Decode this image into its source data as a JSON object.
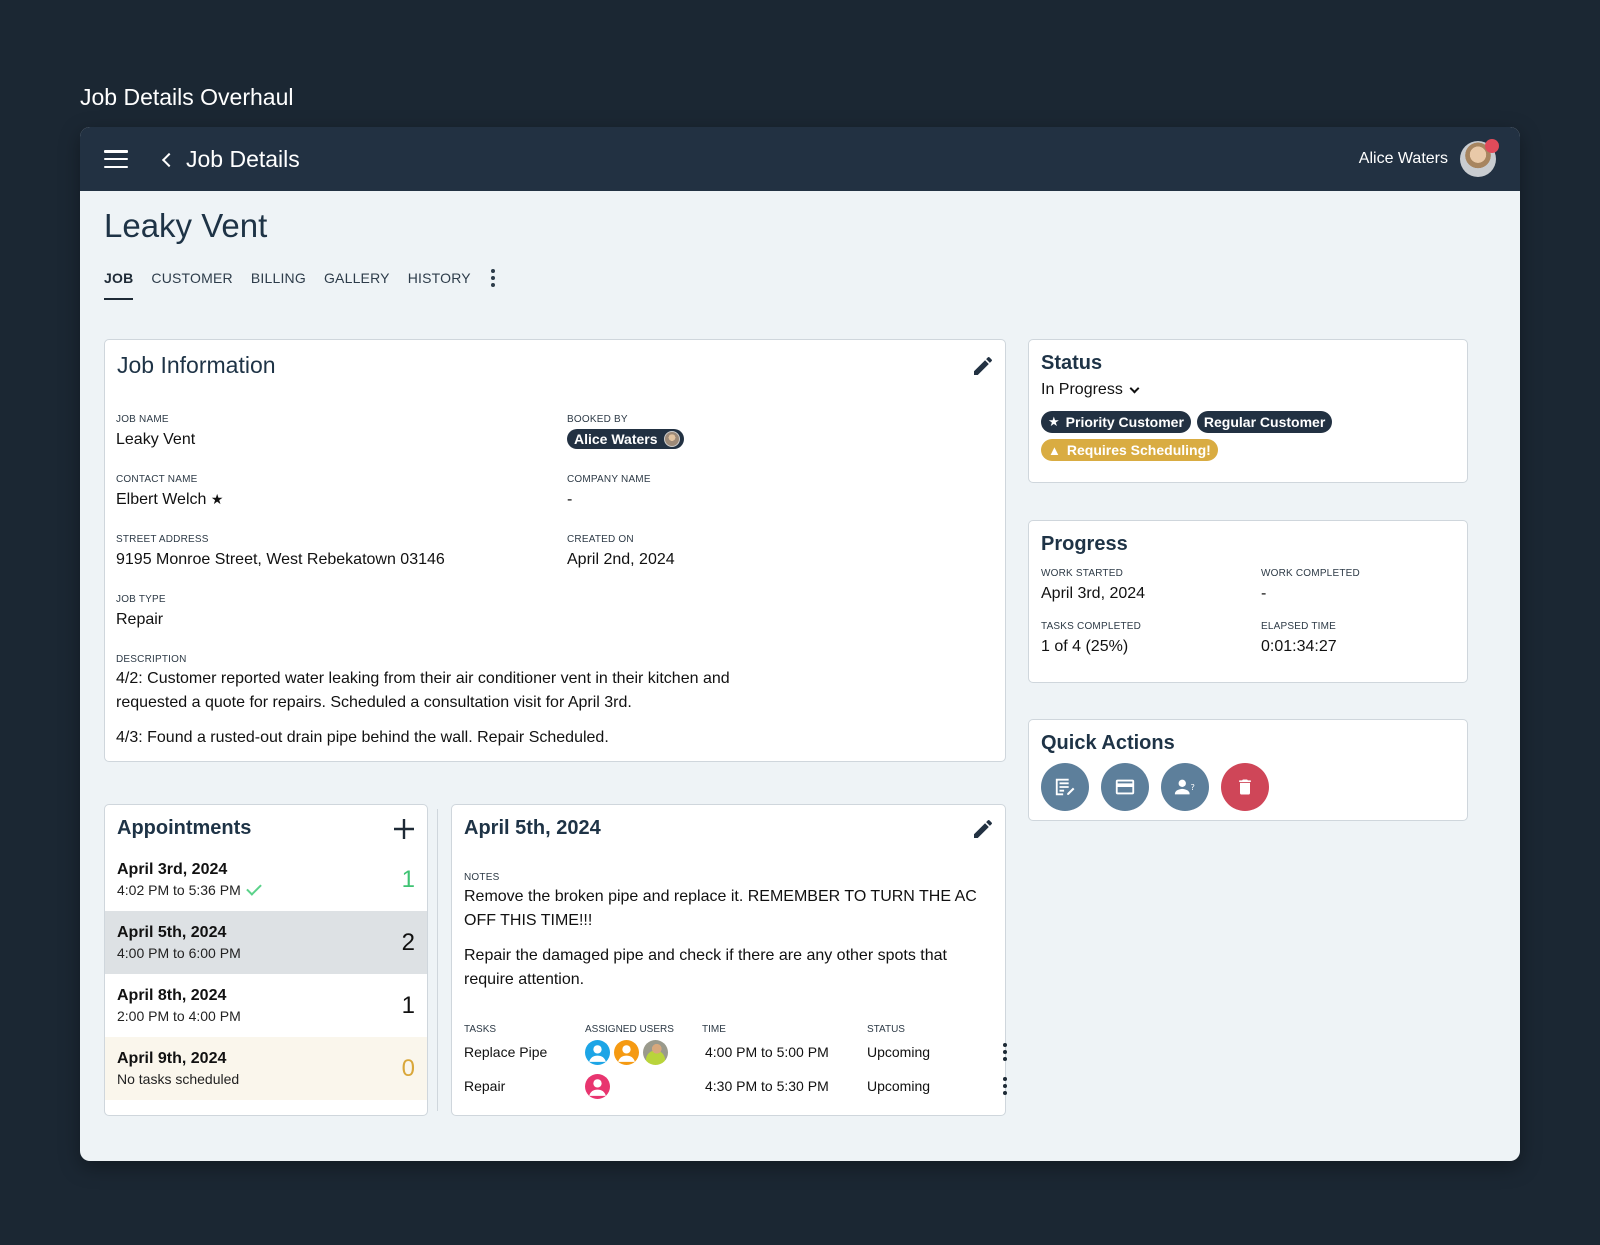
{
  "page_heading": "Job Details Overhaul",
  "topbar": {
    "title": "Job Details",
    "user_name": "Alice Waters"
  },
  "job_title": "Leaky Vent",
  "tabs": [
    {
      "label": "JOB",
      "active": true
    },
    {
      "label": "CUSTOMER"
    },
    {
      "label": "BILLING"
    },
    {
      "label": "GALLERY"
    },
    {
      "label": "HISTORY"
    }
  ],
  "job_info": {
    "title": "Job Information",
    "fields": {
      "job_name": {
        "label": "JOB NAME",
        "value": "Leaky Vent"
      },
      "booked_by": {
        "label": "BOOKED BY",
        "value": "Alice Waters"
      },
      "contact_name": {
        "label": "CONTACT NAME",
        "value": "Elbert Welch"
      },
      "company_name": {
        "label": "COMPANY NAME",
        "value": "-"
      },
      "street_address": {
        "label": "STREET ADDRESS",
        "value": "9195 Monroe Street, West Rebekatown 03146"
      },
      "created_on": {
        "label": "CREATED ON",
        "value": "April 2nd, 2024"
      },
      "job_type": {
        "label": "JOB TYPE",
        "value": "Repair"
      }
    },
    "description": {
      "label": "DESCRIPTION",
      "paragraphs": [
        "4/2: Customer reported water leaking from their air conditioner vent in their kitchen and requested a quote for repairs. Scheduled a consultation visit for April 3rd.",
        "4/3: Found a rusted-out drain pipe behind the wall. Repair Scheduled."
      ]
    }
  },
  "status": {
    "title": "Status",
    "selected": "In Progress",
    "tags": [
      {
        "label": "Priority Customer",
        "icon": "star-icon"
      },
      {
        "label": "Regular Customer"
      },
      {
        "label": "Requires Scheduling!",
        "icon": "warning-icon",
        "color": "#d9ac42"
      }
    ]
  },
  "progress": {
    "title": "Progress",
    "work_started": {
      "label": "WORK STARTED",
      "value": "April 3rd, 2024"
    },
    "work_completed": {
      "label": "WORK COMPLETED",
      "value": "-"
    },
    "tasks_completed": {
      "label": "TASKS COMPLETED",
      "value": "1 of 4 (25%)"
    },
    "elapsed_time": {
      "label": "ELAPSED TIME",
      "value": "0:01:34:27"
    }
  },
  "quick_actions": {
    "title": "Quick Actions",
    "buttons": [
      "notes-edit-icon",
      "credit-card-icon",
      "user-question-icon",
      "trash-icon"
    ]
  },
  "appointments": {
    "title": "Appointments",
    "items": [
      {
        "date": "April 3rd, 2024",
        "time": "4:02 PM to 5:36 PM",
        "count": "1",
        "completed": true
      },
      {
        "date": "April 5th, 2024",
        "time": "4:00 PM to 6:00 PM",
        "count": "2",
        "selected": true
      },
      {
        "date": "April 8th, 2024",
        "time": "2:00 PM to 4:00 PM",
        "count": "1"
      },
      {
        "date": "April 9th, 2024",
        "time": "No tasks scheduled",
        "count": "0"
      }
    ]
  },
  "appointment_detail": {
    "title": "April 5th, 2024",
    "notes_label": "NOTES",
    "notes": [
      "Remove the broken pipe and replace it. REMEMBER TO TURN THE AC OFF THIS TIME!!!",
      "Repair the damaged pipe and check if there are any other spots that require attention."
    ],
    "task_headers": [
      "TASKS",
      "ASSIGNED USERS",
      "TIME",
      "STATUS"
    ],
    "tasks": [
      {
        "name": "Replace Pipe",
        "time": "4:00 PM to 5:00 PM",
        "status": "Upcoming"
      },
      {
        "name": "Repair",
        "time": "4:30 PM to 5:30 PM",
        "status": "Upcoming"
      }
    ]
  },
  "colors": {
    "topbar": "#223142",
    "accent_dark": "#223142",
    "warning": "#d9ac42",
    "success": "#3fc373",
    "danger": "#cf4658",
    "action": "#5d7f9b"
  }
}
